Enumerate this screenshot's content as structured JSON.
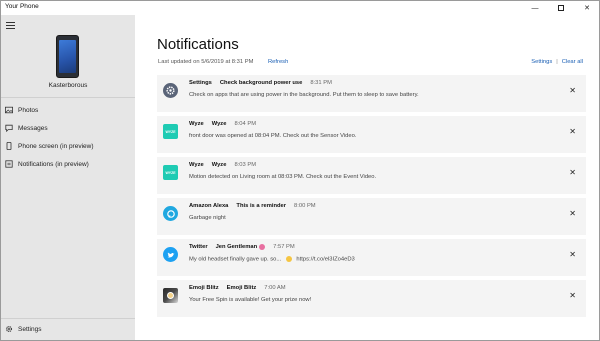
{
  "window": {
    "title": "Your Phone",
    "minimize": "—",
    "close": "✕"
  },
  "sidebar": {
    "device_name": "Kasterborous",
    "items": [
      {
        "label": "Photos",
        "icon": "photos-icon"
      },
      {
        "label": "Messages",
        "icon": "messages-icon"
      },
      {
        "label": "Phone screen (in preview)",
        "icon": "phone-screen-icon"
      },
      {
        "label": "Notifications (in preview)",
        "icon": "notifications-icon"
      }
    ],
    "settings_label": "Settings"
  },
  "main": {
    "title": "Notifications",
    "last_updated": "Last updated on 5/6/2019 at 8:31 PM",
    "refresh_label": "Refresh",
    "settings_label": "Settings",
    "separator": "|",
    "clear_all_label": "Clear all"
  },
  "notifications": [
    {
      "app": "Settings",
      "title": "Check background power use",
      "time": "8:31 PM",
      "body": "Check on apps that are using power in the background. Put them to sleep to save battery.",
      "icon": "settings-gear-icon"
    },
    {
      "app": "Wyze",
      "title": "Wyze",
      "time": "8:04 PM",
      "body": "front door was opened at 08:04 PM. Check out the Sensor Video.",
      "icon": "wyze-icon",
      "icon_text": "WYZE"
    },
    {
      "app": "Wyze",
      "title": "Wyze",
      "time": "8:03 PM",
      "body": "Motion detected on Living room at 08:03 PM. Check out the Event Video.",
      "icon": "wyze-icon",
      "icon_text": "WYZE"
    },
    {
      "app": "Amazon Alexa",
      "title": "This is a reminder",
      "time": "8:00 PM",
      "body": "Garbage night",
      "icon": "alexa-icon"
    },
    {
      "app": "Twitter",
      "title": "Jen Gentleman",
      "time": "7:57 PM",
      "body_pre": "My old headset finally gave up. so...",
      "body_post": "https://t.co/el3IZo4eD3",
      "icon": "twitter-bird-icon"
    },
    {
      "app": "Emoji Blitz",
      "title": "Emoji Blitz",
      "time": "7:00 AM",
      "body": "Your Free Spin is available! Get your prize now!",
      "icon": "emoji-blitz-icon"
    }
  ],
  "dismiss_glyph": "✕",
  "colors": {
    "accent": "#1a5fb4",
    "sidebar": "#e6e6e6",
    "card": "#f4f4f4",
    "wyze": "#1ecbb3",
    "twitter": "#1da1f2",
    "alexa": "#20a8e0",
    "settings_icon": "#5a6478"
  }
}
